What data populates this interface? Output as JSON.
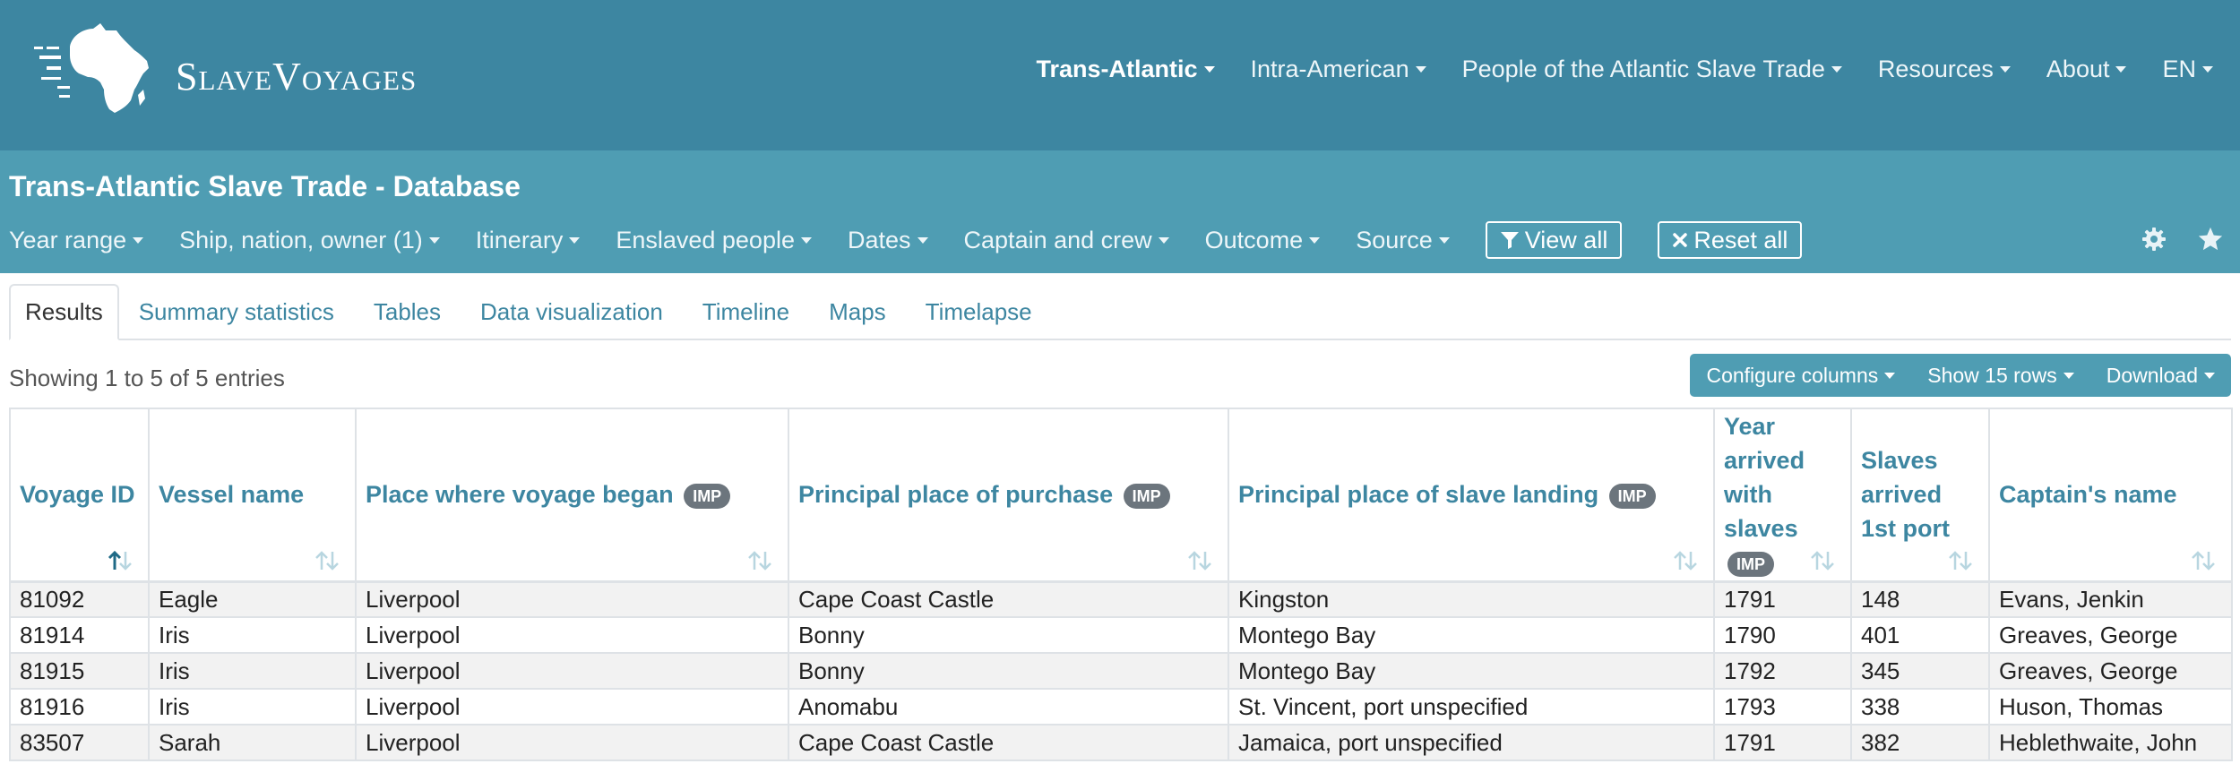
{
  "brand": {
    "name": "SlaveVoyages"
  },
  "topnav": [
    {
      "label": "Trans-Atlantic",
      "active": true
    },
    {
      "label": "Intra-American",
      "active": false
    },
    {
      "label": "People of the Atlantic Slave Trade",
      "active": false
    },
    {
      "label": "Resources",
      "active": false
    },
    {
      "label": "About",
      "active": false
    },
    {
      "label": "EN",
      "active": false
    }
  ],
  "page": {
    "title": "Trans-Atlantic Slave Trade - Database"
  },
  "filters": [
    "Year range",
    "Ship, nation, owner (1)",
    "Itinerary",
    "Enslaved people",
    "Dates",
    "Captain and crew",
    "Outcome",
    "Source"
  ],
  "actions": {
    "view_all": "View all",
    "reset_all": "Reset all"
  },
  "tabs": [
    {
      "label": "Results",
      "active": true
    },
    {
      "label": "Summary statistics",
      "active": false
    },
    {
      "label": "Tables",
      "active": false
    },
    {
      "label": "Data visualization",
      "active": false
    },
    {
      "label": "Timeline",
      "active": false
    },
    {
      "label": "Maps",
      "active": false
    },
    {
      "label": "Timelapse",
      "active": false
    }
  ],
  "entries": {
    "showing": "Showing 1 to 5 of 5 entries"
  },
  "table_tools": {
    "configure": "Configure columns",
    "rows": "Show 15 rows",
    "download": "Download"
  },
  "table": {
    "imp_badge": "IMP",
    "columns": [
      {
        "label": "Voyage ID",
        "imp": false
      },
      {
        "label": "Vessel name",
        "imp": false
      },
      {
        "label": "Place where voyage began",
        "imp": true
      },
      {
        "label": "Principal place of purchase",
        "imp": true
      },
      {
        "label": "Principal place of slave landing",
        "imp": true
      },
      {
        "label": "Year arrived with slaves",
        "imp": true
      },
      {
        "label": "Slaves arrived 1st port",
        "imp": false
      },
      {
        "label": "Captain's name",
        "imp": false
      }
    ],
    "rows": [
      [
        "81092",
        "Eagle",
        "Liverpool",
        "Cape Coast Castle",
        "Kingston",
        "1791",
        "148",
        "Evans, Jenkin"
      ],
      [
        "81914",
        "Iris",
        "Liverpool",
        "Bonny",
        "Montego Bay",
        "1790",
        "401",
        "Greaves, George"
      ],
      [
        "81915",
        "Iris",
        "Liverpool",
        "Bonny",
        "Montego Bay",
        "1792",
        "345",
        "Greaves, George"
      ],
      [
        "81916",
        "Iris",
        "Liverpool",
        "Anomabu",
        "St. Vincent, port unspecified",
        "1793",
        "338",
        "Huson, Thomas"
      ],
      [
        "83507",
        "Sarah",
        "Liverpool",
        "Cape Coast Castle",
        "Jamaica, port unspecified",
        "1791",
        "382",
        "Heblethwaite, John"
      ]
    ]
  },
  "colors": {
    "topbar": "#3d86a1",
    "subbar": "#4f9db3",
    "accent": "#3d86a1",
    "imp_badge": "#6c757d"
  }
}
